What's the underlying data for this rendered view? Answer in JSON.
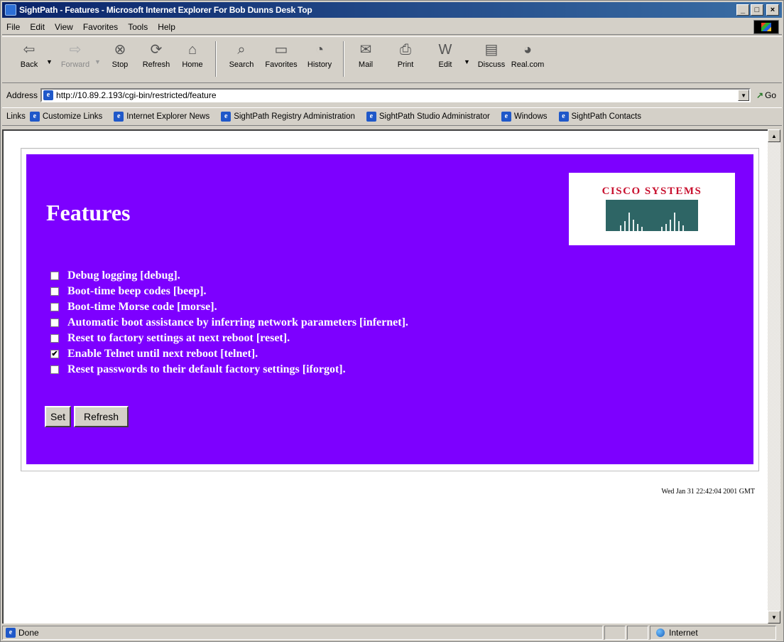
{
  "window": {
    "title": "SightPath - Features - Microsoft Internet Explorer For Bob Dunns Desk Top",
    "controls": {
      "minimize": "_",
      "maximize": "□",
      "close": "×"
    }
  },
  "menu": [
    "File",
    "Edit",
    "View",
    "Favorites",
    "Tools",
    "Help"
  ],
  "toolbar": {
    "back": "Back",
    "forward": "Forward",
    "stop": "Stop",
    "refresh": "Refresh",
    "home": "Home",
    "search": "Search",
    "favorites": "Favorites",
    "history": "History",
    "mail": "Mail",
    "print": "Print",
    "edit": "Edit",
    "discuss": "Discuss",
    "realcom": "Real.com"
  },
  "address": {
    "label": "Address",
    "url": "http://10.89.2.193/cgi-bin/restricted/feature",
    "go": "Go"
  },
  "links": {
    "label": "Links",
    "items": [
      "Customize Links",
      "Internet Explorer News",
      "SightPath Registry Administration",
      "SightPath Studio Administrator",
      "Windows",
      "SightPath Contacts"
    ]
  },
  "page": {
    "title": "Features",
    "logo_text": "CISCO SYSTEMS",
    "features": [
      {
        "label": "Debug logging [debug].",
        "checked": false
      },
      {
        "label": "Boot-time beep codes [beep].",
        "checked": false
      },
      {
        "label": "Boot-time Morse code [morse].",
        "checked": false
      },
      {
        "label": "Automatic boot assistance by inferring network parameters [infernet].",
        "checked": false
      },
      {
        "label": "Reset to factory settings at next reboot [reset].",
        "checked": false
      },
      {
        "label": "Enable Telnet until next reboot [telnet].",
        "checked": true
      },
      {
        "label": "Reset passwords to their default factory settings [iforgot].",
        "checked": false
      }
    ],
    "set_button": "Set",
    "refresh_button": "Refresh",
    "timestamp": "Wed Jan 31 22:42:04 2001 GMT",
    "panel_color": "#7d00ff"
  },
  "status": {
    "text": "Done",
    "zone": "Internet"
  },
  "icons": {
    "ie": "e",
    "check": "✔"
  }
}
